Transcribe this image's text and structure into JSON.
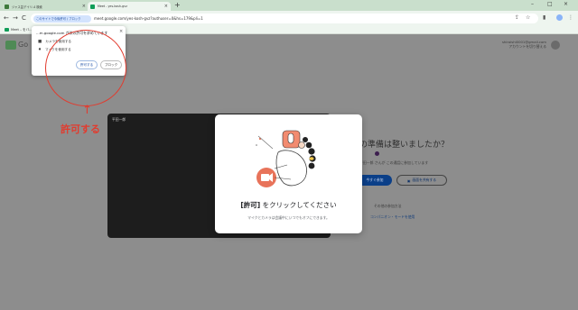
{
  "browser": {
    "tabs": [
      {
        "title": "ジャス芸デイリ-4 検索",
        "active": false
      },
      {
        "title": "Meet - yes-kosh-gvz",
        "active": true
      }
    ],
    "new_tab": "+",
    "window_controls": {
      "minimize": "–",
      "maximize": "□",
      "close": "×"
    },
    "nav": {
      "back": "←",
      "forward": "→",
      "reload": "C"
    },
    "site_chip": "このサイトで今後許可 / ブロック",
    "url": "meet.google.com/yes-kosh-gvz?authuser=0&hs=179&pli=1",
    "bookmark": "Meet – をバ..."
  },
  "meet": {
    "logo_text": "Go",
    "account_email": "shiroishi0001@gmail.com",
    "account_switch": "アカウントを切り替える",
    "preview_name": "平田一郎",
    "ready_title": "の準備は整いましたか？",
    "joined_text": "平田一郎 さんが この通話に参加しています",
    "join_button": "今すぐ参加",
    "present_button": "画面を共有する",
    "other_options": "その他の参加方法",
    "companion": "コンパニオン・モードを使用"
  },
  "modal": {
    "title_bracket": "[許可]",
    "title_rest": " をクリックしてください",
    "description": "マイクとカメラは会議中にいつでもオフにできます。"
  },
  "permission_popup": {
    "title": "...m.google.com が次の許可を求めています",
    "rows": [
      {
        "icon": "camera-icon",
        "label": "カメラを使用する"
      },
      {
        "icon": "mic-icon",
        "label": "マイクを使用する"
      }
    ],
    "allow": "許可する",
    "block": "ブロック"
  },
  "annotation": {
    "arrow": "↑",
    "label": "許可する",
    "color": "#e23b2e"
  }
}
